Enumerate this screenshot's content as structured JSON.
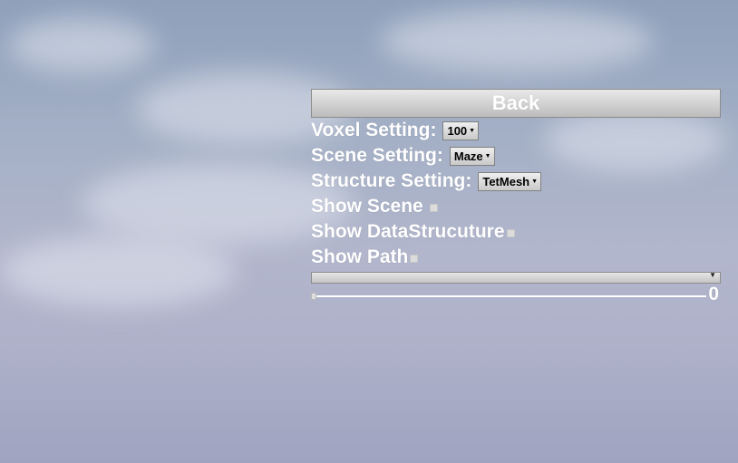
{
  "back_button": {
    "label": "Back"
  },
  "voxel_setting": {
    "label": "Voxel Setting:",
    "value": "100"
  },
  "scene_setting": {
    "label": "Scene Setting:",
    "value": "Maze"
  },
  "structure_setting": {
    "label": "Structure Setting:",
    "value": "TetMesh"
  },
  "show_scene": {
    "label": "Show Scene",
    "checked": false
  },
  "show_data_structure": {
    "label": "Show DataStrucuture",
    "checked": false
  },
  "show_path": {
    "label": "Show Path",
    "checked": false
  },
  "path_combo": {
    "value": ""
  },
  "slider": {
    "value": "0"
  },
  "icons": {
    "dropdown": "chevron-down-icon"
  },
  "colors": {
    "label_text": "#ffffff",
    "button_bg": "#d4d4d4",
    "checkbox": "#dcdcdc"
  }
}
